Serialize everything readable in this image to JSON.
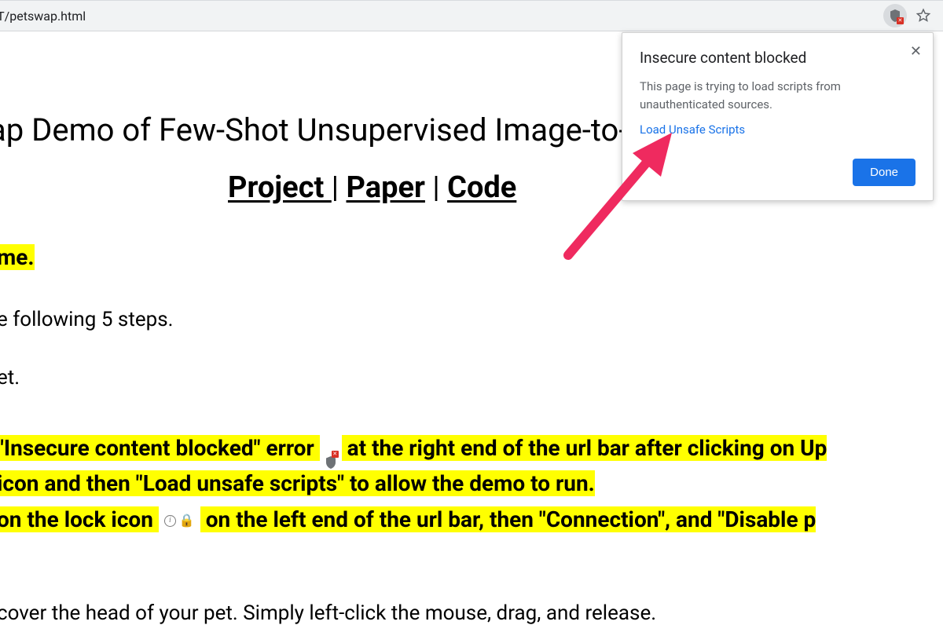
{
  "address_bar": {
    "url_fragment": "IT/petswap.html"
  },
  "popup": {
    "title": "Insecure content blocked",
    "body": "This page is trying to load scripts from unauthenticated sources.",
    "link": "Load Unsafe Scripts",
    "done": "Done"
  },
  "page": {
    "title_fragment": "ap Demo of Few-Shot Unsupervised Image-to-I",
    "nav": {
      "project": "Project ",
      "paper": "Paper",
      "code": "Code",
      "sep": " | "
    },
    "line_me": "me.",
    "line_steps": "e following 5 steps.",
    "line_et": "et.",
    "hl_row1_a": "\"Insecure content blocked\" error ",
    "hl_row1_b": " at the right end of the url bar after clicking on Up",
    "hl_row2": " icon and then \"Load unsafe scripts\" to allow the demo to run.",
    "hl_row3_a": " on the lock icon ",
    "hl_row3_b": " on the left end of the url bar, then \"Connection\", and \"Disable p",
    "line_cover": "cover the head of your pet. Simply left-click the mouse, drag, and release."
  }
}
